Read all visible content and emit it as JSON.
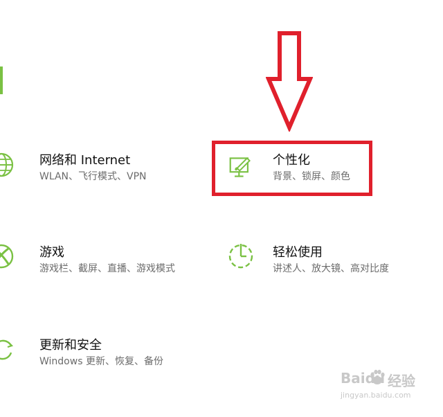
{
  "colors": {
    "accent": "#7ac143",
    "highlight": "#e0202c"
  },
  "tiles": [
    {
      "title": "网络和 Internet",
      "desc": "WLAN、飞行模式、VPN",
      "icon": "globe-icon"
    },
    {
      "title": "个性化",
      "desc": "背景、锁屏、颜色",
      "icon": "paint-monitor-icon"
    },
    {
      "title": "游戏",
      "desc": "游戏栏、截屏、直播、游戏模式",
      "icon": "xbox-icon"
    },
    {
      "title": "轻松使用",
      "desc": "讲述人、放大镜、高对比度",
      "icon": "ease-of-access-icon"
    },
    {
      "title": "更新和安全",
      "desc": "Windows 更新、恢复、备份",
      "icon": "sync-icon"
    }
  ],
  "watermark": {
    "brand": "Baidu",
    "sub": "经验",
    "url": "jingyan.baidu.com"
  }
}
